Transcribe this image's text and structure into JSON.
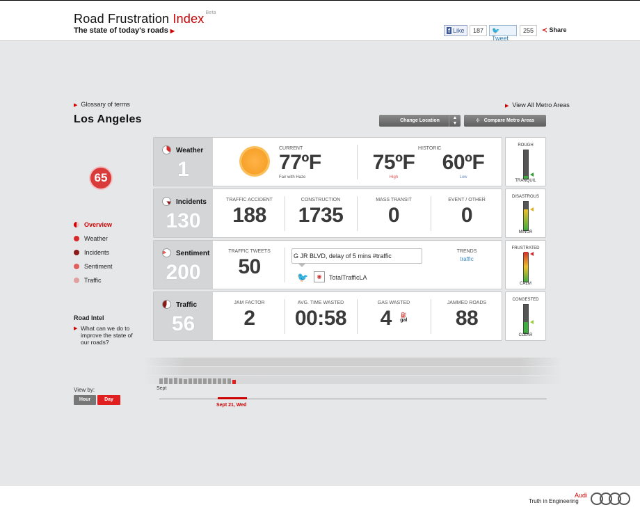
{
  "header": {
    "title_main": "Road Frustration",
    "title_accent": "Index",
    "beta": "Beta",
    "tagline": "The state of today's roads",
    "like_label": "Like",
    "like_count": "187",
    "tweet_label": "Tweet",
    "tweet_count": "255",
    "share_label": "Share"
  },
  "links": {
    "glossary": "Glossary of terms",
    "view_all": "View All Metro Areas"
  },
  "location": {
    "city": "Los Angeles",
    "change_button": "Change Location",
    "compare_button": "Compare Metro Areas"
  },
  "score": "65",
  "nav": [
    {
      "label": "Overview",
      "color": "#cc0000"
    },
    {
      "label": "Weather",
      "color": "#d92a2a"
    },
    {
      "label": "Incidents",
      "color": "#8a1a1a"
    },
    {
      "label": "Sentiment",
      "color": "#e06060"
    },
    {
      "label": "Traffic",
      "color": "#e0a0a0"
    }
  ],
  "road_intel": {
    "title": "Road Intel",
    "question": "What can we do to improve the state of our roads?"
  },
  "weather": {
    "label": "Weather",
    "value": "1",
    "current_caption": "CURRENT",
    "current_temp": "77ºF",
    "condition": "Fair with Haze",
    "historic_caption": "HISTORIC",
    "high_temp": "75ºF",
    "high_label": "High",
    "low_temp": "60ºF",
    "low_label": "Low",
    "meter_top": "ROUGH",
    "meter_bottom": "TRANQUIL"
  },
  "incidents": {
    "label": "Incidents",
    "value": "130",
    "items": [
      {
        "caption": "TRAFFIC ACCIDENT",
        "value": "188"
      },
      {
        "caption": "CONSTRUCTION",
        "value": "1735"
      },
      {
        "caption": "MASS TRANSIT",
        "value": "0"
      },
      {
        "caption": "EVENT / OTHER",
        "value": "0"
      }
    ],
    "meter_top": "DISASTROUS",
    "meter_bottom": "MINOR"
  },
  "sentiment": {
    "label": "Sentiment",
    "value": "200",
    "tweets_caption": "TRAFFIC TWEETS",
    "tweets_value": "50",
    "tweet_text": "G JR BLVD, delay of 5 mins #traffic",
    "tweet_handle": "TotalTrafficLA",
    "trends_caption": "TRENDS",
    "trend_link": "traffic",
    "meter_top": "FRUSTRATED",
    "meter_bottom": "CALM"
  },
  "traffic": {
    "label": "Traffic",
    "value": "56",
    "items": [
      {
        "caption": "JAM FACTOR",
        "value": "2"
      },
      {
        "caption": "AVG. TIME WASTED",
        "value": "00:58"
      },
      {
        "caption": "GAS WASTED",
        "value": "4",
        "unit": "gal"
      },
      {
        "caption": "JAMMED ROADS",
        "value": "88"
      }
    ],
    "meter_top": "CONGESTED",
    "meter_bottom": "CLEAR"
  },
  "timeline": {
    "month_label": "Sept",
    "selected_date": "Sept 21, Wed",
    "view_by": "View by:",
    "hour_button": "Hour",
    "day_button": "Day"
  },
  "footer": {
    "brand": "Audi",
    "slogan": "Truth in Engineering"
  }
}
